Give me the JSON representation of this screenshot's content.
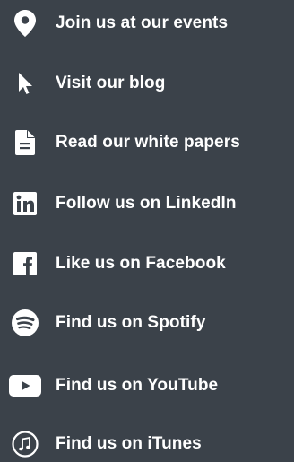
{
  "links": [
    {
      "label": "Join us at our events",
      "icon": "map-pin-icon"
    },
    {
      "label": "Visit our blog",
      "icon": "cursor-arrow-icon"
    },
    {
      "label": "Read our white papers",
      "icon": "document-icon"
    },
    {
      "label": "Follow us on LinkedIn",
      "icon": "linkedin-icon"
    },
    {
      "label": "Like us on Facebook",
      "icon": "facebook-icon"
    },
    {
      "label": "Find us on Spotify",
      "icon": "spotify-icon"
    },
    {
      "label": "Find us on YouTube",
      "icon": "youtube-icon"
    },
    {
      "label": "Find us on iTunes",
      "icon": "itunes-icon"
    }
  ],
  "colors": {
    "background": "#3b424a",
    "text": "#ffffff",
    "icon": "#ffffff"
  }
}
